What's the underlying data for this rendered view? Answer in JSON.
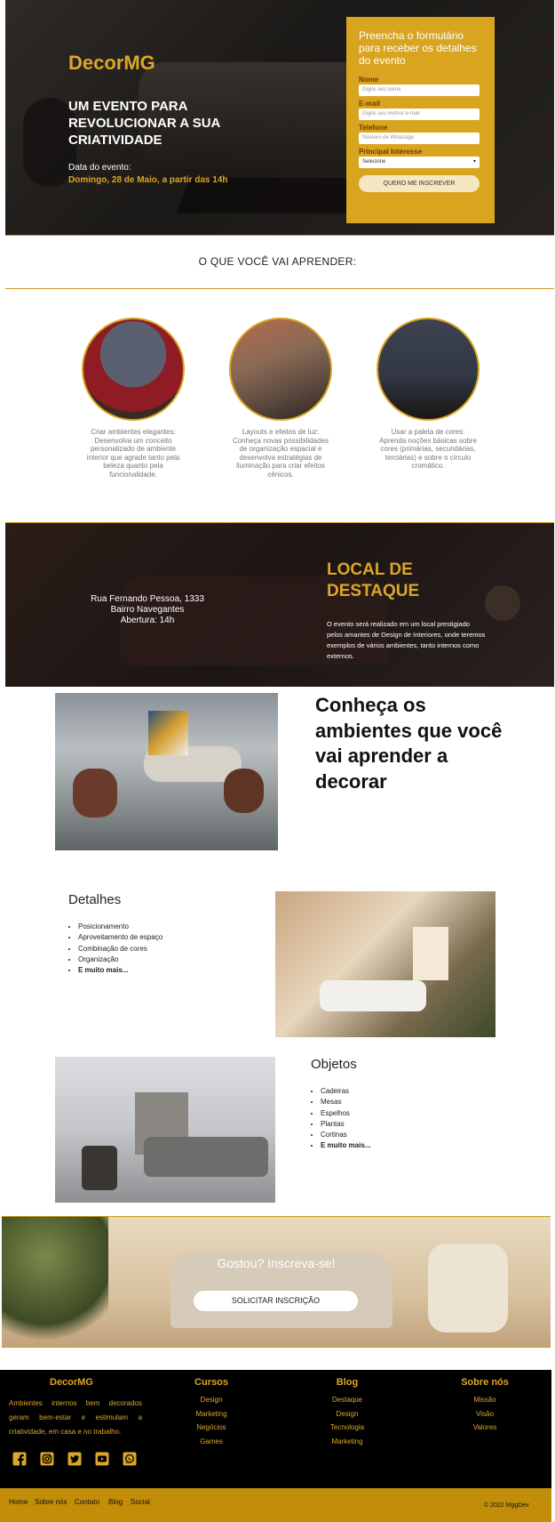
{
  "hero": {
    "logo": "DecorMG",
    "headline": "UM EVENTO PARA REVOLUCIONAR A SUA CRIATIVIDADE",
    "date_label": "Data do evento:",
    "date_value": "Domingo, 28 de Maio, a partir das 14h"
  },
  "form": {
    "title": "Preencha o formulário para receber os detalhes do evento",
    "name_label": "Nome",
    "name_placeholder": "Digite seu nome",
    "email_label": "E-mail",
    "email_placeholder": "Digite seu melhor e-mail",
    "phone_label": "Telefone",
    "phone_placeholder": "Número de Whatsapp",
    "interest_label": "Principal Interesse",
    "interest_selected": "Selecione",
    "submit_label": "QUERO ME INSCREVER"
  },
  "learn": {
    "title": "O QUE VOCÊ VAI APRENDER:",
    "items": [
      {
        "caption": "Criar ambientes elegantes: Desenvolva um conceito personalizado de ambiente interior que agrade tanto pela beleza quanto pela funcionalidade."
      },
      {
        "caption": "Layouts e efeitos de luz: Conheça novas possibilidades de organização espacial e desenvolva estratégias de iluminação para criar efeitos cênicos."
      },
      {
        "caption": "Usar a paleta de cores: Aprenda noções básicas sobre cores (primárias, secundárias, terciárias) e sobre o círculo cromático."
      }
    ]
  },
  "location": {
    "address_line1": "Rua Fernando Pessoa, 1333",
    "address_line2": "Bairro Navegantes",
    "address_line3": "Abertura: 14h",
    "title": "LOCAL DE DESTAQUE",
    "text": "O evento será realizado em um local prestigiado pelos amantes de Design de Interiores, onde teremos exemplos de vários ambientes, tanto internos como externos."
  },
  "rooms": {
    "title": "Conheça os ambientes que você vai aprender a decorar"
  },
  "details": {
    "title": "Detalhes",
    "items": [
      "Posicionamento",
      "Aproveitamento de espaço",
      "Combinação de cores",
      "Organização",
      "E muito mais..."
    ]
  },
  "objects": {
    "title": "Objetos",
    "items": [
      "Cadeiras",
      "Mesas",
      "Espelhos",
      "Plantas",
      "Cortinas",
      "E muito mais..."
    ]
  },
  "cta": {
    "title": "Gostou? Inscreva-se!",
    "button": "SOLICITAR INSCRIÇÃO"
  },
  "footer": {
    "brand": "DecorMG",
    "description": "Ambientes internos bem decorados geram bem-estar e estimulam a criatividade, em casa e no trabalho.",
    "columns": [
      {
        "title": "Cursos",
        "links": [
          "Design",
          "Marketing",
          "Negócios",
          "Games"
        ]
      },
      {
        "title": "Blog",
        "links": [
          "Destaque",
          "Design",
          "Tecnologia",
          "Marketing"
        ]
      },
      {
        "title": "Sobre nós",
        "links": [
          "Missão",
          "Visão",
          "Valores"
        ]
      }
    ],
    "social_icons": [
      "facebook-icon",
      "instagram-icon",
      "twitter-icon",
      "youtube-icon",
      "whatsapp-icon"
    ],
    "bottom_nav": [
      "Home",
      "Sobre nós",
      "Contato",
      "Blog",
      "Social"
    ],
    "copyright": "© 2022 MggDev"
  },
  "colors": {
    "accent": "#dca628",
    "dark": "#000000",
    "bar": "#c28e0a"
  }
}
